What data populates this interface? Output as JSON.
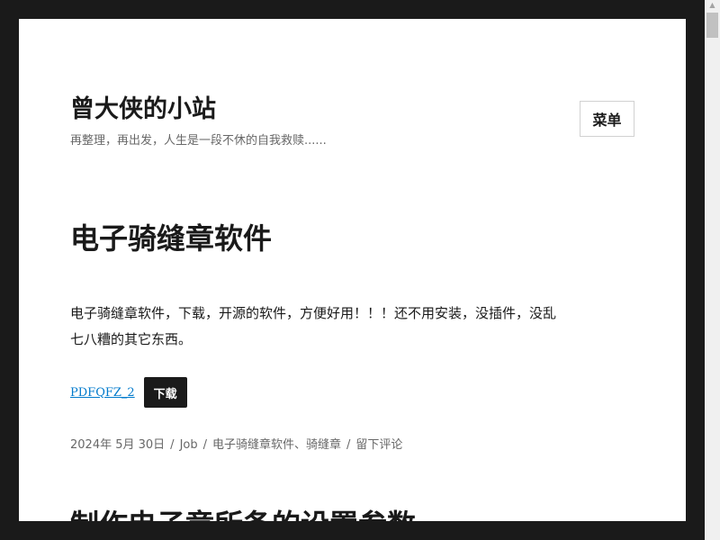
{
  "header": {
    "site_title": "曾大侠的小站",
    "site_description": "再整理，再出发，人生是一段不休的自我救赎......",
    "menu_label": "菜单"
  },
  "post": {
    "title": "电子骑缝章软件",
    "content": "电子骑缝章软件，下载，开源的软件，方便好用！！！还不用安装，没插件，没乱七八糟的其它东西。",
    "file_link": "PDFQFZ_2",
    "download_label": "下载",
    "meta": {
      "date": "2024年 5月 30日",
      "category": "Job",
      "tags": "电子骑缝章软件、骑缝章",
      "comment": "留下评论",
      "separator": "/"
    }
  },
  "next_post": {
    "title": "制作电子章所备的设置参数"
  },
  "scrollbar": {
    "up_arrow": "▲"
  }
}
